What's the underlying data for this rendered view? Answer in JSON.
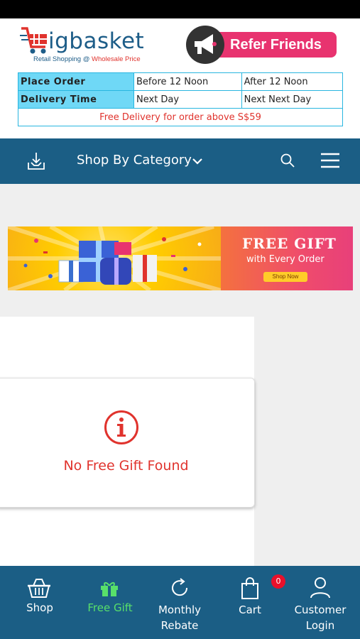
{
  "header": {
    "logo_text": "igbasket",
    "tagline_part1": "Retail Shopping @ ",
    "tagline_part2": "Wholesale Price",
    "refer_label": "Refer Friends"
  },
  "delivery_table": {
    "rows": [
      {
        "label": "Place Order",
        "col1": "Before 12 Noon",
        "col2": "After 12 Noon"
      },
      {
        "label": "Delivery Time",
        "col1": "Next Day",
        "col2": "Next Next Day"
      }
    ],
    "free_delivery": "Free Delivery for order above S$59"
  },
  "nav": {
    "category_label": "Shop By Category"
  },
  "banner": {
    "title": "FREE GIFT",
    "subtitle": "with Every Order",
    "button": "Shop Now"
  },
  "empty_state": {
    "message": "No Free Gift Found"
  },
  "bottom_nav": {
    "shop": "Shop",
    "free_gift": "Free Gift",
    "monthly_line1": "Monthly",
    "monthly_line2": "Rebate",
    "cart": "Cart",
    "cart_count": "0",
    "customer_line1": "Customer",
    "customer_line2": "Login"
  },
  "colors": {
    "brand_blue": "#1b5e85",
    "accent_red": "#e0332d",
    "accent_pink": "#e8336f",
    "active_green": "#58e06a"
  }
}
